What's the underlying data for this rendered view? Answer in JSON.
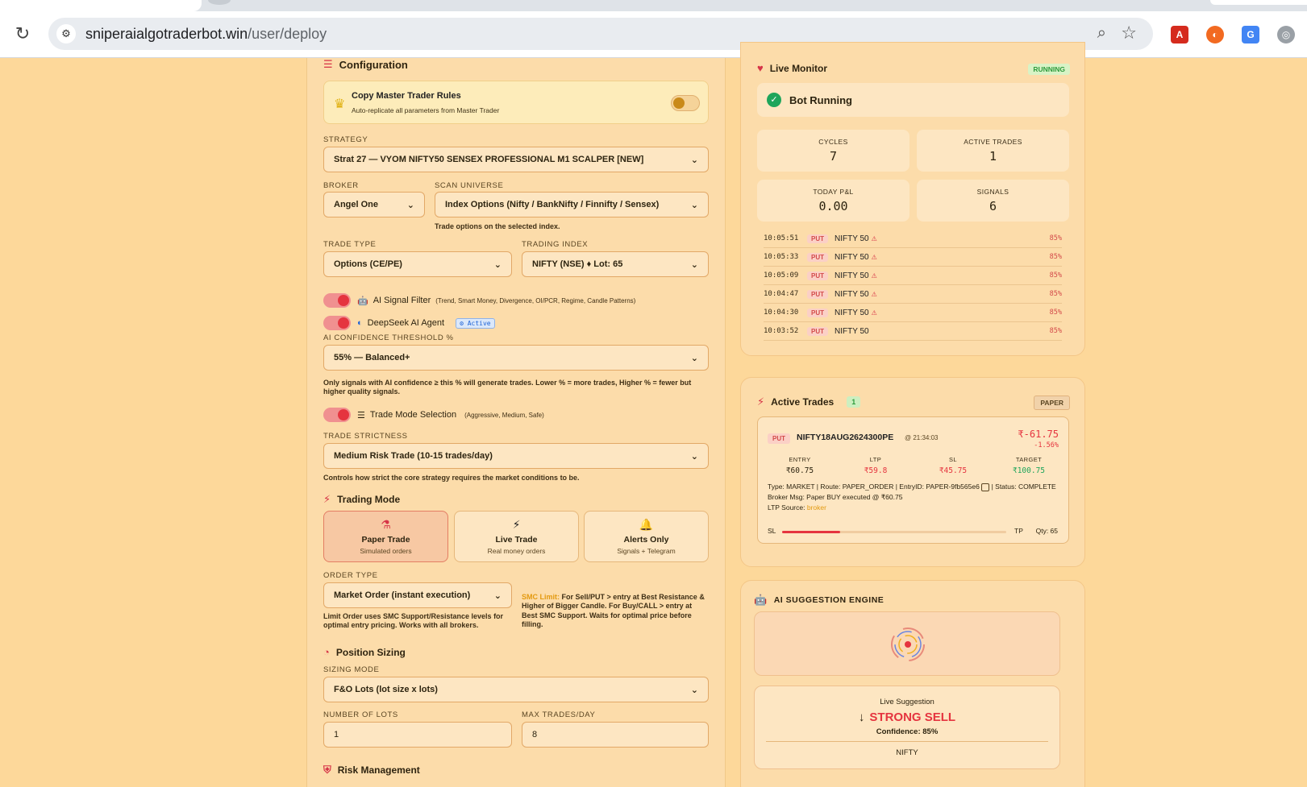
{
  "browser": {
    "url_host": "sniperaialgotraderbot.win",
    "url_path": "/user/deploy"
  },
  "config": {
    "title": "Configuration",
    "copy_master": {
      "title": "Copy Master Trader Rules",
      "subtitle": "Auto-replicate all parameters from Master Trader"
    },
    "strategy": {
      "label": "STRATEGY",
      "value": "Strat 27 — VYOM NIFTY50 SENSEX PROFESSIONAL M1 SCALPER [NEW]"
    },
    "broker": {
      "label": "BROKER",
      "value": "Angel One"
    },
    "scan_universe": {
      "label": "SCAN UNIVERSE",
      "value": "Index Options (Nifty / BankNifty / Finnifty / Sensex)",
      "hint": "Trade options on the selected index."
    },
    "trade_type": {
      "label": "TRADE TYPE",
      "value": "Options (CE/PE)"
    },
    "trading_index": {
      "label": "TRADING INDEX",
      "value": "NIFTY (NSE) ♦ Lot: 65"
    },
    "ai_signal_filter": {
      "label": "AI Signal Filter",
      "detail": "(Trend, Smart Money, Divergence, OI/PCR, Regime, Candle Patterns)"
    },
    "deepseek": {
      "label": "DeepSeek AI Agent",
      "badge": "Active"
    },
    "ai_confidence": {
      "label": "AI CONFIDENCE THRESHOLD %",
      "value": "55% — Balanced+",
      "hint": "Only signals with AI confidence ≥ this % will generate trades. Lower % = more trades, Higher % = fewer but higher quality signals."
    },
    "trade_mode_selection": {
      "label": "Trade Mode Selection",
      "detail": "(Aggressive, Medium, Safe)"
    },
    "trade_strictness": {
      "label": "TRADE STRICTNESS",
      "value": "Medium Risk Trade (10-15 trades/day)",
      "hint": "Controls how strict the core strategy requires the market conditions to be."
    },
    "trading_mode": {
      "title": "Trading Mode",
      "options": [
        {
          "title": "Paper Trade",
          "subtitle": "Simulated orders"
        },
        {
          "title": "Live Trade",
          "subtitle": "Real money orders"
        },
        {
          "title": "Alerts Only",
          "subtitle": "Signals + Telegram"
        }
      ]
    },
    "order_type": {
      "label": "ORDER TYPE",
      "value": "Market Order (instant execution)",
      "hint": "Limit Order uses SMC Support/Resistance levels for optimal entry pricing. Works with all brokers.",
      "smc_title": "SMC Limit:",
      "smc_text_1": " For Sell/PUT > entry at ",
      "smc_bold_1": "Best Resistance & Higher of Bigger Candle",
      "smc_text_2": ". For Buy/CALL > entry at ",
      "smc_bold_2": "Best SMC Support",
      "smc_text_3": ". Waits for optimal price before filling."
    },
    "position_sizing": {
      "title": "Position Sizing"
    },
    "sizing_mode": {
      "label": "SIZING MODE",
      "value": "F&O Lots (lot size x lots)"
    },
    "num_lots": {
      "label": "NUMBER OF LOTS",
      "value": "1"
    },
    "max_trades": {
      "label": "MAX TRADES/DAY",
      "value": "8"
    },
    "risk_management": {
      "title": "Risk Management"
    }
  },
  "monitor": {
    "title": "Live Monitor",
    "status_badge": "RUNNING",
    "bot_status": "Bot Running",
    "stats": [
      {
        "label": "CYCLES",
        "value": "7"
      },
      {
        "label": "ACTIVE TRADES",
        "value": "1"
      },
      {
        "label": "TODAY P&L",
        "value": "0.00"
      },
      {
        "label": "SIGNALS",
        "value": "6"
      }
    ],
    "signals": [
      {
        "time": "10:05:51",
        "side": "PUT",
        "symbol": "NIFTY 50",
        "warn": "⚠",
        "pct": "85%"
      },
      {
        "time": "10:05:33",
        "side": "PUT",
        "symbol": "NIFTY 50",
        "warn": "⚠",
        "pct": "85%"
      },
      {
        "time": "10:05:09",
        "side": "PUT",
        "symbol": "NIFTY 50",
        "warn": "⚠",
        "pct": "85%"
      },
      {
        "time": "10:04:47",
        "side": "PUT",
        "symbol": "NIFTY 50",
        "warn": "⚠",
        "pct": "85%"
      },
      {
        "time": "10:04:30",
        "side": "PUT",
        "symbol": "NIFTY 50",
        "warn": "⚠",
        "pct": "85%"
      },
      {
        "time": "10:03:52",
        "side": "PUT",
        "symbol": "NIFTY 50",
        "warn": "",
        "pct": "85%"
      }
    ]
  },
  "active_trades": {
    "title": "Active Trades",
    "count": "1",
    "mode_badge": "PAPER",
    "trade": {
      "side": "PUT",
      "symbol": "NIFTY18AUG2624300PE",
      "time": "@ 21:34:03",
      "pnl": "₹-61.75",
      "pnl_pct": "-1.56%",
      "entry_label": "ENTRY",
      "entry": "₹60.75",
      "ltp_label": "LTP",
      "ltp": "₹59.8",
      "sl_label": "SL",
      "sl": "₹45.75",
      "target_label": "TARGET",
      "target": "₹100.75",
      "details_line1": "Type: MARKET | Route: PAPER_ORDER | EntryID: PAPER-9fb565e6",
      "details_status": " | Status: COMPLETE",
      "broker_msg": "Broker Msg: Paper BUY executed @ ₹60.75",
      "ltp_source_label": "LTP Source: ",
      "ltp_source": "broker",
      "sl_tag": "SL",
      "tp_tag": "TP",
      "qty": "Qty: 65",
      "progress": 0.26
    }
  },
  "ai_suggestion": {
    "title": "AI SUGGESTION ENGINE",
    "live_label": "Live Suggestion",
    "signal": "STRONG SELL",
    "confidence": "Confidence: 85%",
    "symbol": "NIFTY"
  }
}
